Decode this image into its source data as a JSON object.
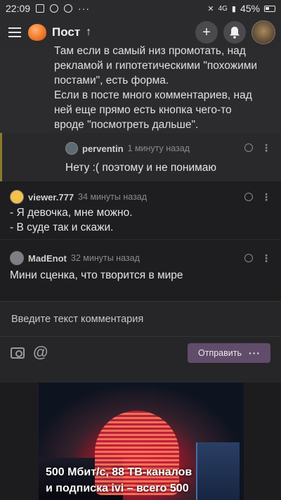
{
  "status_bar": {
    "time": "22:09",
    "network": "4G",
    "battery": "45%",
    "more": "···"
  },
  "header": {
    "title": "Пост",
    "up_arrow": "↑",
    "add_icon": "+"
  },
  "thread": {
    "parent_text_lines": [
      "Там если в самый низ промотать, над",
      "рекламой и гипотетическими \"похожими",
      "постами\", есть форма.",
      "Если в посте много комментариев, над",
      "ней еще прямо есть кнопка чего-то",
      "вроде \"посмотреть дальше\"."
    ],
    "reply": {
      "user": "perventin",
      "time": "1 минуту назад",
      "text": "Нету :( поэтому и не понимаю"
    },
    "comments": [
      {
        "user": "viewer.777",
        "time": "34 минуты назад",
        "lines": [
          "- Я девочка, мне можно.",
          "- В суде так и скажи."
        ],
        "avatar_color": "#f2c14e"
      },
      {
        "user": "MadEnot",
        "time": "32 минуты назад",
        "lines": [
          "Мини сценка, что творится в мире"
        ],
        "avatar_color": "#7c7f86"
      }
    ]
  },
  "comment_form": {
    "placeholder": "Введите текст комментария",
    "send_label": "Отправить",
    "more_label": "···",
    "at_symbol": "@"
  },
  "ad": {
    "line1": "500 Мбит/с, 88 ТВ-каналов",
    "line2": "и подписка ivi – всего 500"
  }
}
